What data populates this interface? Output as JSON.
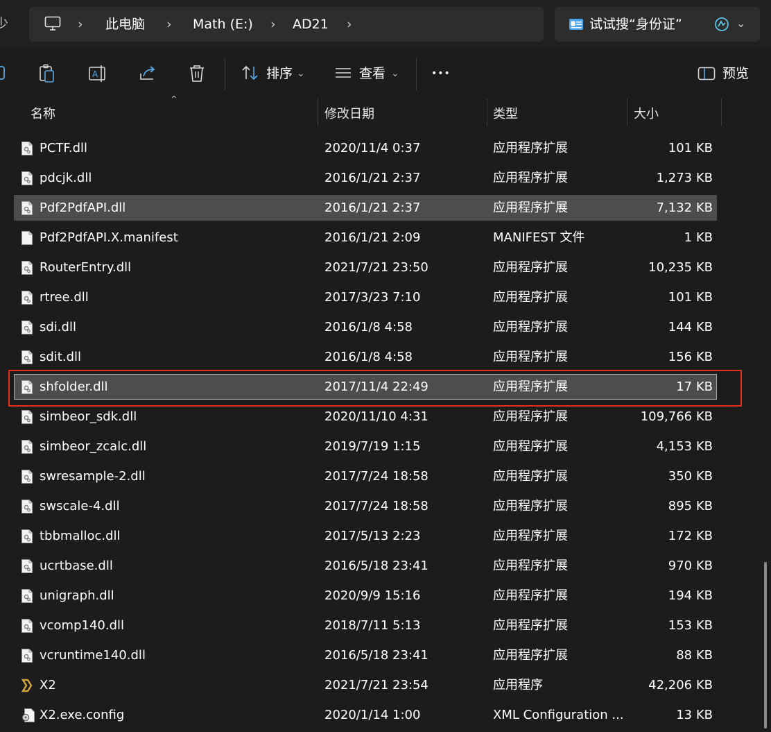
{
  "address": {
    "crumbs": [
      "此电脑",
      "Math (E:)",
      "AD21"
    ],
    "left_clip": "少"
  },
  "search": {
    "placeholder": "试试搜“身份证”"
  },
  "toolbar": {
    "sort_label": "排序",
    "view_label": "查看",
    "more_label": "•••",
    "preview_label": "预览"
  },
  "columns": {
    "name": "名称",
    "date": "修改日期",
    "type": "类型",
    "size": "大小"
  },
  "files": [
    {
      "name": "PCTF.dll",
      "date": "2020/11/4 0:37",
      "type": "应用程序扩展",
      "size": "101 KB",
      "icon": "dll-file-icon"
    },
    {
      "name": "pdcjk.dll",
      "date": "2016/1/21 2:37",
      "type": "应用程序扩展",
      "size": "1,273 KB",
      "icon": "dll-file-icon"
    },
    {
      "name": "Pdf2PdfAPI.dll",
      "date": "2016/1/21 2:37",
      "type": "应用程序扩展",
      "size": "7,132 KB",
      "icon": "dll-file-icon",
      "state": "selected"
    },
    {
      "name": "Pdf2PdfAPI.X.manifest",
      "date": "2016/1/21 2:09",
      "type": "MANIFEST 文件",
      "size": "1 KB",
      "icon": "blank-file-icon"
    },
    {
      "name": "RouterEntry.dll",
      "date": "2021/7/21 23:50",
      "type": "应用程序扩展",
      "size": "10,235 KB",
      "icon": "dll-file-icon"
    },
    {
      "name": "rtree.dll",
      "date": "2017/3/23 7:10",
      "type": "应用程序扩展",
      "size": "101 KB",
      "icon": "dll-file-icon"
    },
    {
      "name": "sdi.dll",
      "date": "2016/1/8 4:58",
      "type": "应用程序扩展",
      "size": "144 KB",
      "icon": "dll-file-icon"
    },
    {
      "name": "sdit.dll",
      "date": "2016/1/8 4:58",
      "type": "应用程序扩展",
      "size": "156 KB",
      "icon": "dll-file-icon"
    },
    {
      "name": "shfolder.dll",
      "date": "2017/11/4 22:49",
      "type": "应用程序扩展",
      "size": "17 KB",
      "icon": "dll-file-icon",
      "state": "focused"
    },
    {
      "name": "simbeor_sdk.dll",
      "date": "2020/11/10 4:31",
      "type": "应用程序扩展",
      "size": "109,766 KB",
      "icon": "dll-file-icon"
    },
    {
      "name": "simbeor_zcalc.dll",
      "date": "2019/7/19 1:15",
      "type": "应用程序扩展",
      "size": "4,153 KB",
      "icon": "dll-file-icon"
    },
    {
      "name": "swresample-2.dll",
      "date": "2017/7/24 18:58",
      "type": "应用程序扩展",
      "size": "350 KB",
      "icon": "dll-file-icon"
    },
    {
      "name": "swscale-4.dll",
      "date": "2017/7/24 18:58",
      "type": "应用程序扩展",
      "size": "895 KB",
      "icon": "dll-file-icon"
    },
    {
      "name": "tbbmalloc.dll",
      "date": "2017/5/13 2:23",
      "type": "应用程序扩展",
      "size": "172 KB",
      "icon": "dll-file-icon"
    },
    {
      "name": "ucrtbase.dll",
      "date": "2016/5/18 23:41",
      "type": "应用程序扩展",
      "size": "970 KB",
      "icon": "dll-file-icon"
    },
    {
      "name": "unigraph.dll",
      "date": "2020/9/9 15:16",
      "type": "应用程序扩展",
      "size": "194 KB",
      "icon": "dll-file-icon"
    },
    {
      "name": "vcomp140.dll",
      "date": "2018/7/11 5:13",
      "type": "应用程序扩展",
      "size": "153 KB",
      "icon": "dll-file-icon"
    },
    {
      "name": "vcruntime140.dll",
      "date": "2016/5/18 23:41",
      "type": "应用程序扩展",
      "size": "88 KB",
      "icon": "dll-file-icon"
    },
    {
      "name": "X2",
      "date": "2021/7/21 23:54",
      "type": "应用程序",
      "size": "42,206 KB",
      "icon": "app-x2-icon"
    },
    {
      "name": "X2.exe.config",
      "date": "2020/1/14 1:00",
      "type": "XML Configuration ...",
      "size": "13 KB",
      "icon": "config-file-icon"
    }
  ],
  "colors": {
    "highlight": "#e0301e",
    "selected_row": "#4d4d4d",
    "x2_icon": "#d4a640"
  }
}
